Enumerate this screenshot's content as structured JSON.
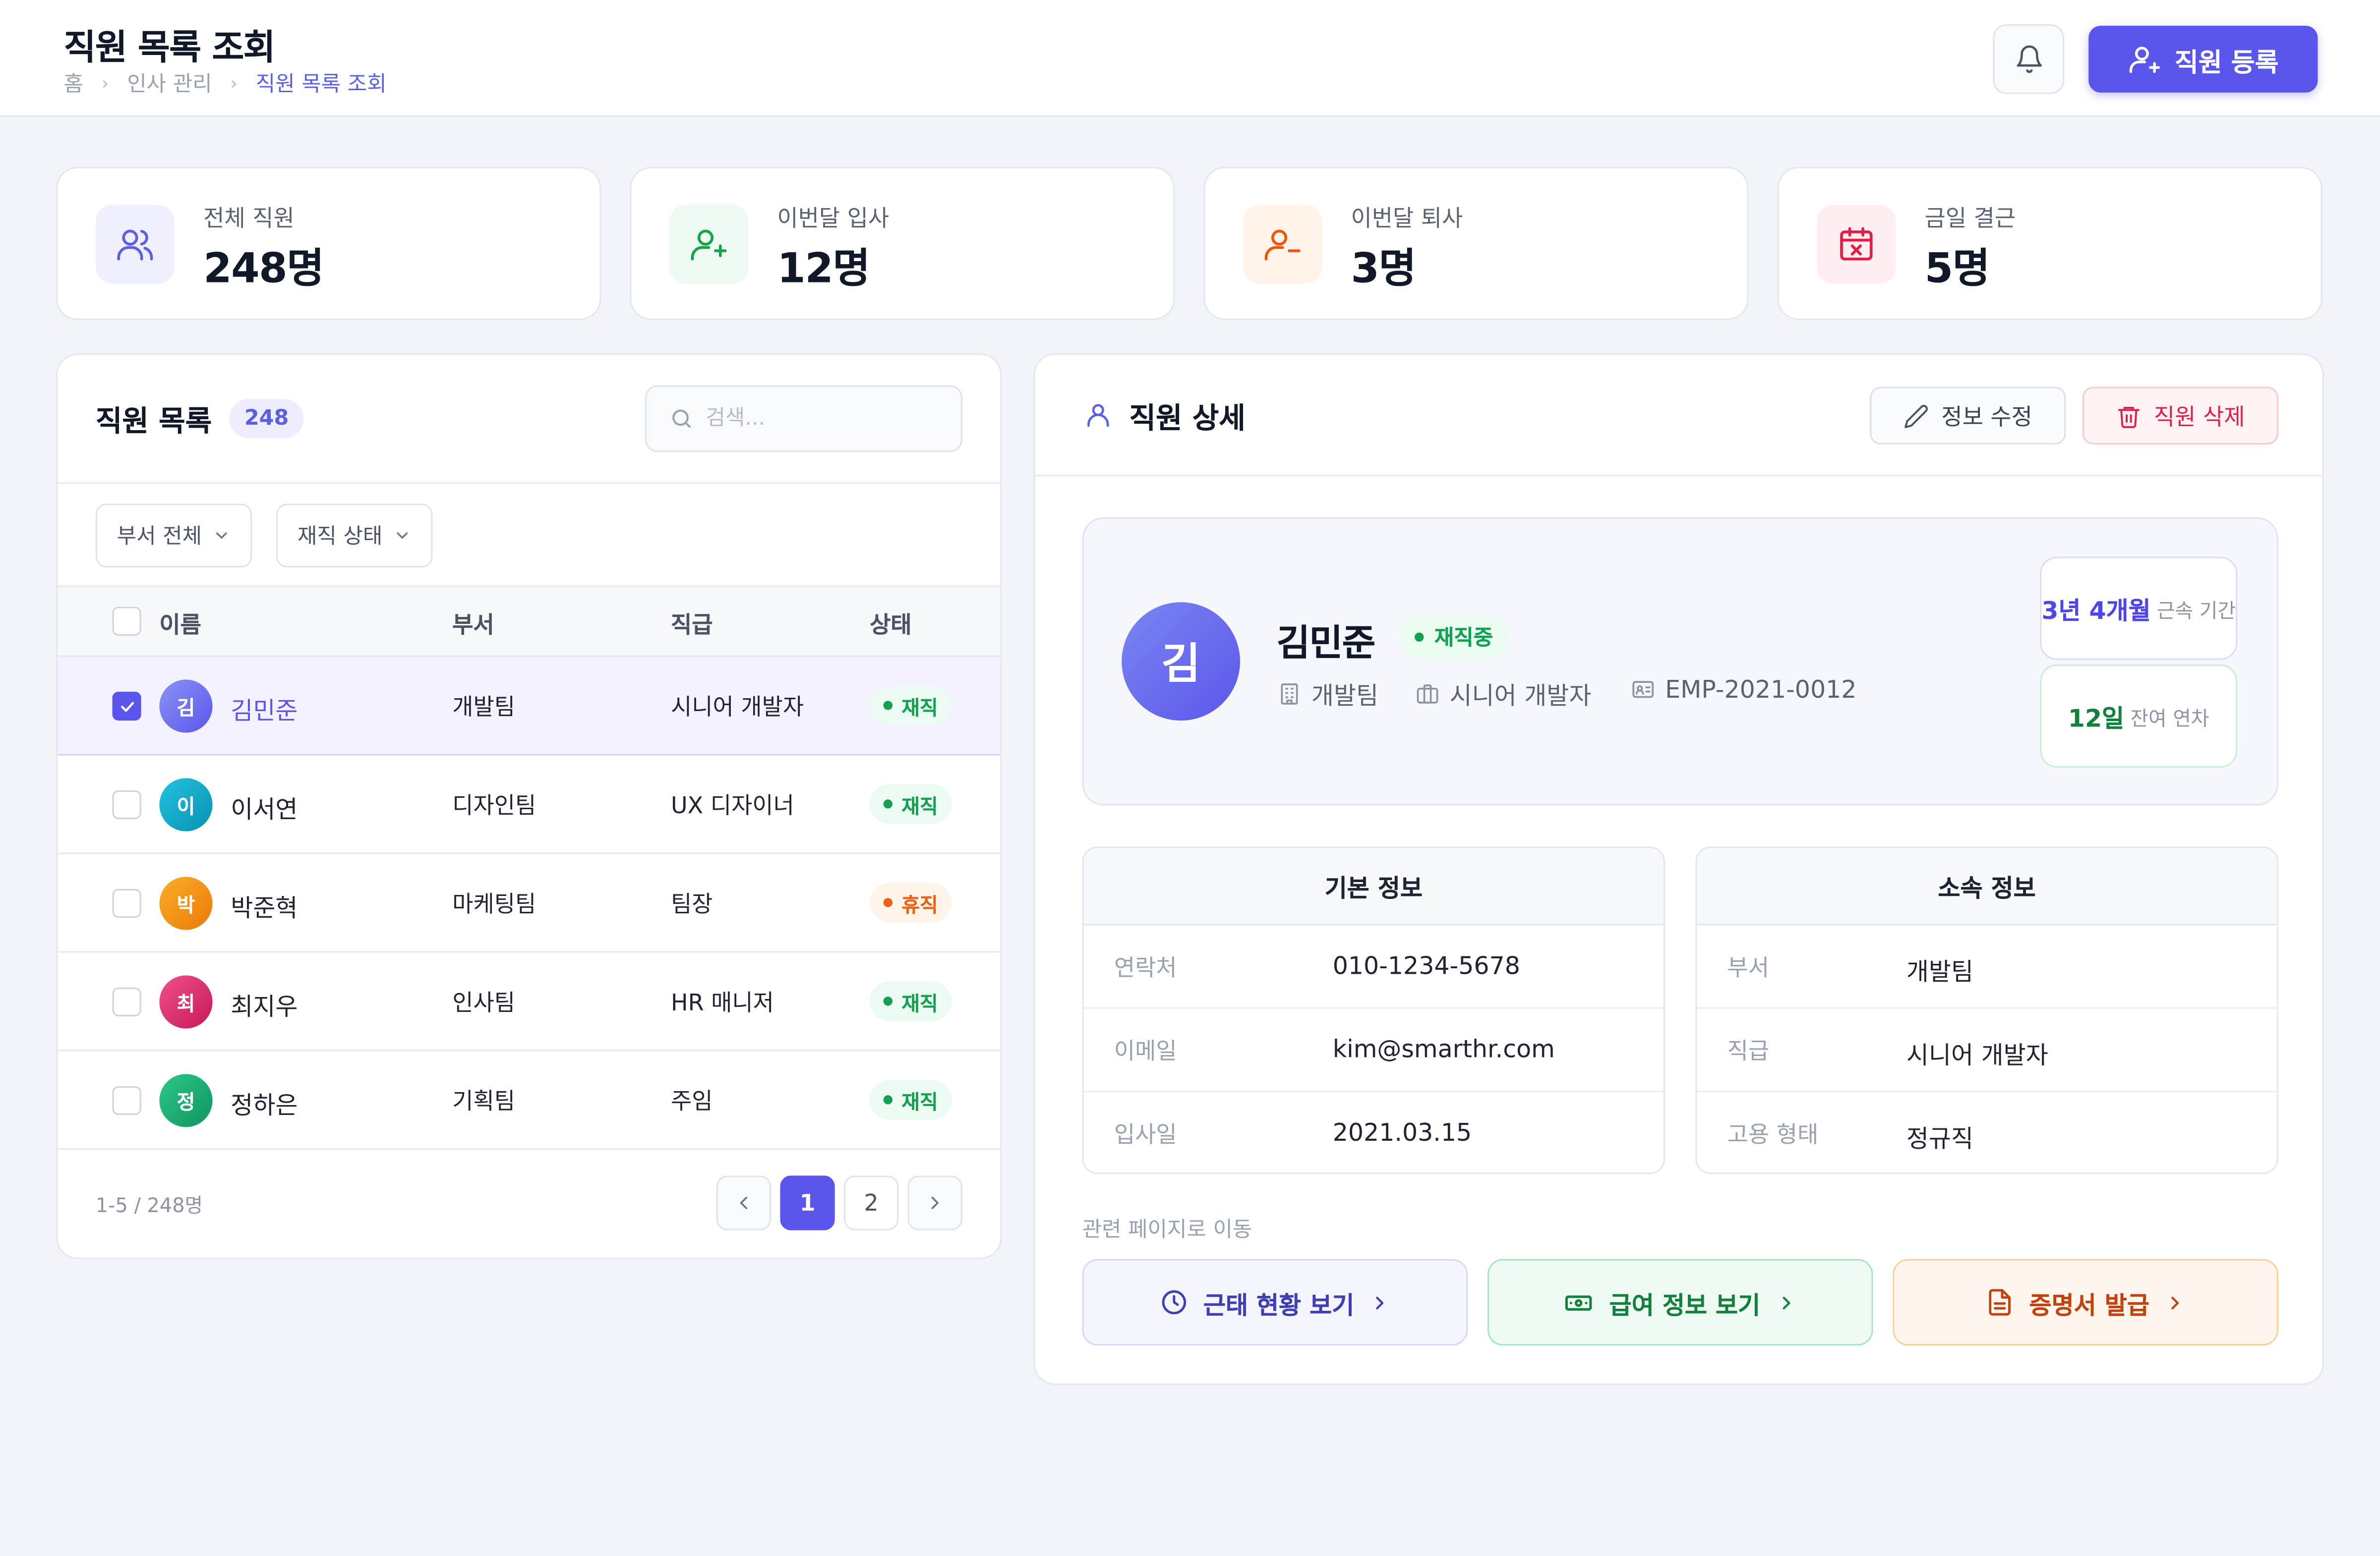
{
  "header": {
    "title": "직원 목록 조회",
    "breadcrumb": [
      "홈",
      "인사 관리",
      "직원 목록 조회"
    ],
    "register_label": "직원 등록",
    "accent": "#5b56eb"
  },
  "stats": [
    {
      "label": "전체 직원",
      "value": "248명",
      "icon": "users-icon",
      "color": "#5b5fe0"
    },
    {
      "label": "이번달 입사",
      "value": "12명",
      "icon": "user-plus-icon",
      "color": "#16a34a"
    },
    {
      "label": "이번달 퇴사",
      "value": "3명",
      "icon": "user-minus-icon",
      "color": "#ea580c"
    },
    {
      "label": "금일 결근",
      "value": "5명",
      "icon": "calendar-x-icon",
      "color": "#e11d48"
    }
  ],
  "list": {
    "title": "직원 목록",
    "count": "248",
    "search_placeholder": "검색...",
    "filters": [
      "부서 전체",
      "재직 상태"
    ],
    "columns": [
      "이름",
      "부서",
      "직급",
      "상태"
    ],
    "rows": [
      {
        "initial": "김",
        "name": "김민준",
        "dept": "개발팀",
        "position": "시니어 개발자",
        "status": "재직",
        "checked": true,
        "avatar_color": "#6b72ee"
      },
      {
        "initial": "이",
        "name": "이서연",
        "dept": "디자인팀",
        "position": "UX 디자이너",
        "status": "재직",
        "checked": false,
        "avatar_color": "#0aa5c7"
      },
      {
        "initial": "박",
        "name": "박준혁",
        "dept": "마케팅팀",
        "position": "팀장",
        "status": "휴직",
        "checked": false,
        "avatar_color": "#f08c0f"
      },
      {
        "initial": "최",
        "name": "최지우",
        "dept": "인사팀",
        "position": "HR 매니저",
        "status": "재직",
        "checked": false,
        "avatar_color": "#db2f6f"
      },
      {
        "initial": "정",
        "name": "정하은",
        "dept": "기획팀",
        "position": "주임",
        "status": "재직",
        "checked": false,
        "avatar_color": "#14a76c"
      }
    ],
    "range_text": "1-5 / 248명",
    "pages": [
      "1",
      "2"
    ],
    "current_page": "1"
  },
  "detail": {
    "title": "직원 상세",
    "edit_label": "정보 수정",
    "delete_label": "직원 삭제",
    "profile": {
      "initial": "김",
      "name": "김민준",
      "status": "재직중",
      "dept": "개발팀",
      "position": "시니어 개발자",
      "emp_id": "EMP-2021-0012",
      "tenure_value": "3년 4개월",
      "tenure_label": "근속 기간",
      "leave_value": "12일",
      "leave_label": "잔여 연차"
    },
    "basic_info": {
      "title": "기본 정보",
      "rows": [
        {
          "key": "연락처",
          "value": "010-1234-5678"
        },
        {
          "key": "이메일",
          "value": "kim@smarthr.com"
        },
        {
          "key": "입사일",
          "value": "2021.03.15"
        }
      ]
    },
    "org_info": {
      "title": "소속 정보",
      "rows": [
        {
          "key": "부서",
          "value": "개발팀"
        },
        {
          "key": "직급",
          "value": "시니어 개발자"
        },
        {
          "key": "고용 형태",
          "value": "정규직"
        }
      ]
    },
    "related_label": "관련 페이지로 이동",
    "links": [
      {
        "label": "근태 현황 보기",
        "icon": "clock-icon"
      },
      {
        "label": "급여 정보 보기",
        "icon": "money-icon"
      },
      {
        "label": "증명서 발급",
        "icon": "document-icon"
      }
    ]
  }
}
